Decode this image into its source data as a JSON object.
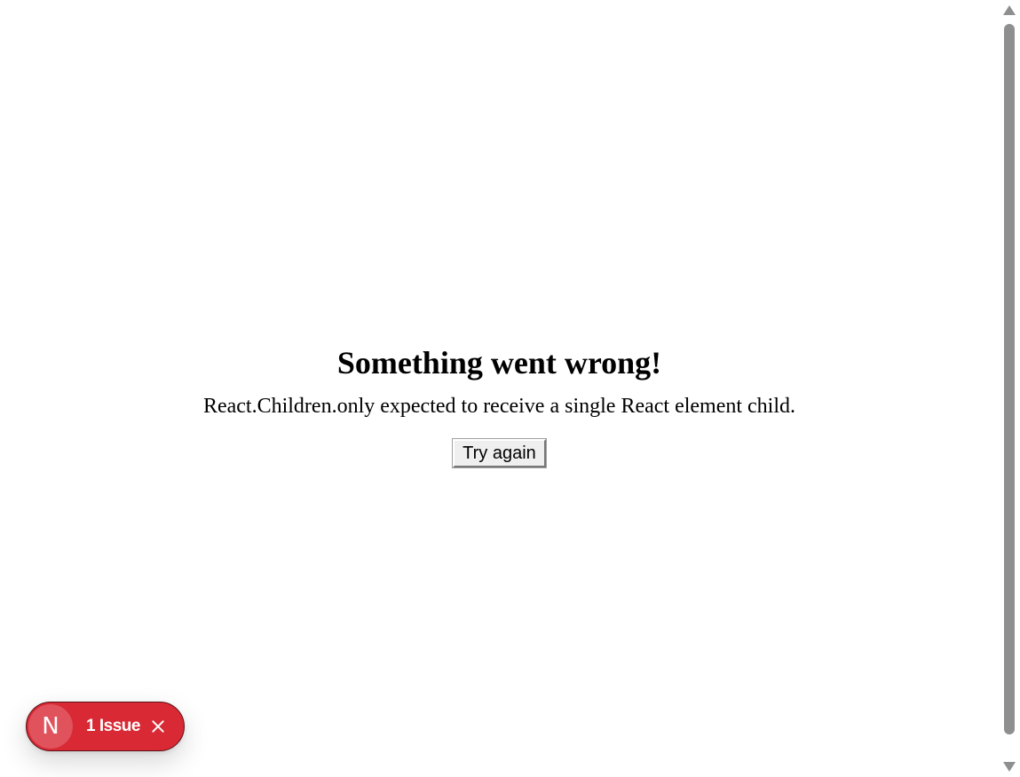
{
  "error": {
    "title": "Something went wrong!",
    "message": "React.Children.only expected to receive a single React element child.",
    "retry_label": "Try again"
  },
  "dev_overlay": {
    "logo_letter": "N",
    "logo_icon": "nextjs-logo-icon",
    "issue_label": "1 Issue",
    "close_icon": "close-icon",
    "badge_color": "#d82934"
  },
  "scrollbar": {
    "up_icon": "scroll-up-arrow-icon",
    "down_icon": "scroll-down-arrow-icon"
  }
}
